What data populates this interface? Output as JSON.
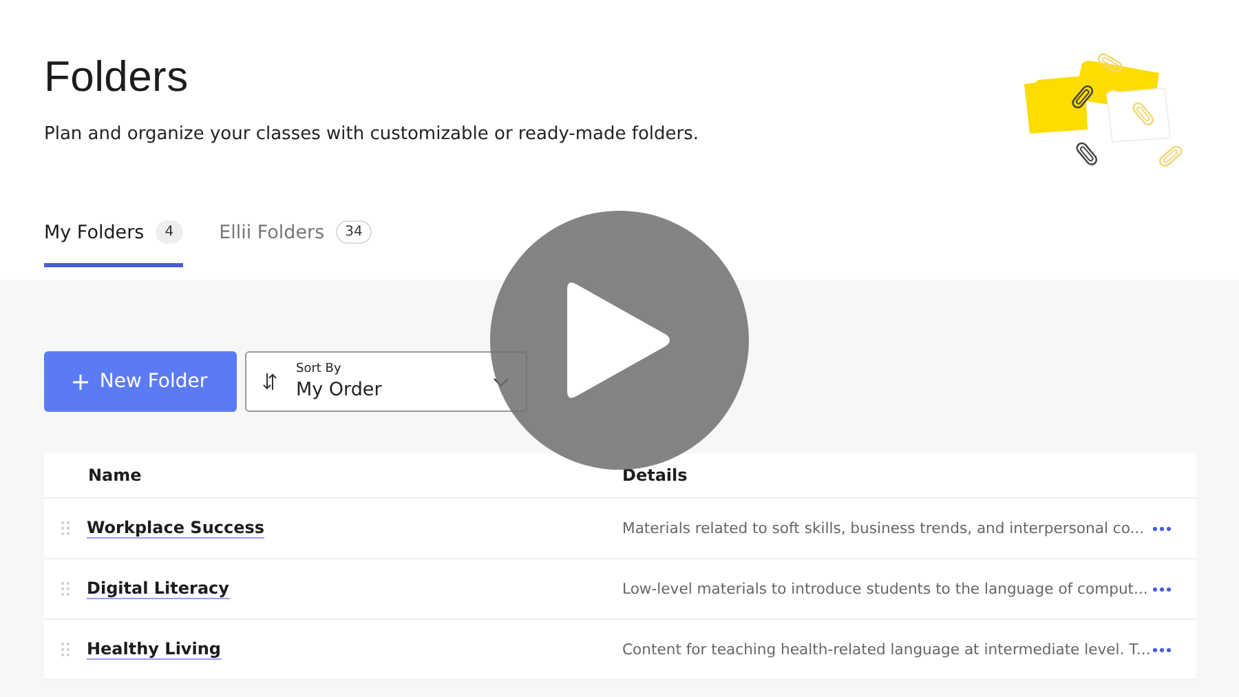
{
  "header": {
    "title": "Folders",
    "subtitle": "Plan and organize your classes with customizable or ready-made folders."
  },
  "tabs": [
    {
      "label": "My Folders",
      "count": "4",
      "selected": true
    },
    {
      "label": "Ellii Folders",
      "count": "34",
      "selected": false
    }
  ],
  "toolbar": {
    "new_button": "New Folder",
    "sort": {
      "label": "Sort By",
      "value": "My Order"
    }
  },
  "table": {
    "columns": [
      "Name",
      "Details"
    ],
    "rows": [
      {
        "name": "Workplace Success",
        "details": "Materials related to soft skills, business trends, and interpersonal co..."
      },
      {
        "name": "Digital Literacy",
        "details": "Low-level materials to introduce students to the language of comput..."
      },
      {
        "name": "Healthy Living",
        "details": "Content for teaching health-related language at intermediate level. T..."
      }
    ]
  },
  "video": {
    "kind": "play_overlay"
  }
}
